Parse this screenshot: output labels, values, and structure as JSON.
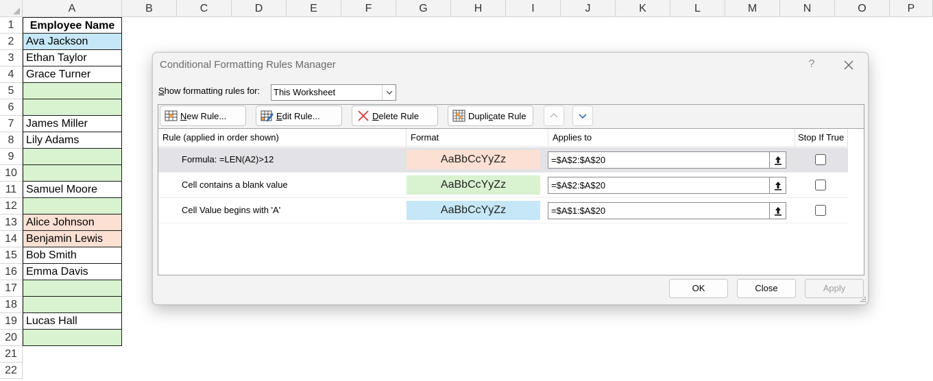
{
  "sheet": {
    "columns": [
      "A",
      "B",
      "C",
      "D",
      "E",
      "F",
      "G",
      "H",
      "I",
      "J",
      "K",
      "L",
      "M",
      "N",
      "O",
      "P"
    ],
    "rows": [
      "1",
      "2",
      "3",
      "4",
      "5",
      "6",
      "7",
      "8",
      "9",
      "10",
      "11",
      "12",
      "13",
      "14",
      "15",
      "16",
      "17",
      "18",
      "19",
      "20",
      "21",
      "22"
    ],
    "colA": [
      {
        "text": "Employee Name",
        "fill": "#ffffff"
      },
      {
        "text": "Ava Jackson",
        "fill": "#c6e7f7"
      },
      {
        "text": "Ethan Taylor",
        "fill": "#ffffff"
      },
      {
        "text": "Grace Turner",
        "fill": "#ffffff"
      },
      {
        "text": "",
        "fill": "#d9f2d0"
      },
      {
        "text": "",
        "fill": "#d9f2d0"
      },
      {
        "text": "James Miller",
        "fill": "#ffffff"
      },
      {
        "text": "Lily Adams",
        "fill": "#ffffff"
      },
      {
        "text": "",
        "fill": "#d9f2d0"
      },
      {
        "text": "",
        "fill": "#d9f2d0"
      },
      {
        "text": "Samuel Moore",
        "fill": "#ffffff"
      },
      {
        "text": "",
        "fill": "#d9f2d0"
      },
      {
        "text": "Alice Johnson",
        "fill": "#fce0d3"
      },
      {
        "text": "Benjamin Lewis",
        "fill": "#fce0d3"
      },
      {
        "text": "Bob Smith",
        "fill": "#ffffff"
      },
      {
        "text": "Emma Davis",
        "fill": "#ffffff"
      },
      {
        "text": "",
        "fill": "#d9f2d0"
      },
      {
        "text": "",
        "fill": "#d9f2d0"
      },
      {
        "text": "Lucas Hall",
        "fill": "#ffffff"
      },
      {
        "text": "",
        "fill": "#d9f2d0"
      }
    ]
  },
  "dialog": {
    "title": "Conditional Formatting Rules Manager",
    "help": "?",
    "show_label_pre": "",
    "show_label_u": "S",
    "show_label_post": "how formatting rules for:",
    "scope_value": "This Worksheet",
    "toolbar": {
      "new_u": "N",
      "new_rest": "ew Rule...",
      "edit_u": "E",
      "edit_rest": "dit Rule...",
      "delete_u": "D",
      "delete_rest": "elete Rule",
      "dup_pre": "Dupli",
      "dup_u": "c",
      "dup_rest": "ate Rule"
    },
    "columns": {
      "rule": "Rule (applied in order shown)",
      "format": "Format",
      "applies": "Applies to",
      "stop": "Stop If True"
    },
    "rules": [
      {
        "rule": "Formula: =LEN(A2)>12",
        "preview": "AaBbCcYyZz",
        "fill": "#fce0d3",
        "applies_to": "=$A$2:$A$20",
        "selected": true
      },
      {
        "rule": "Cell contains a blank value",
        "preview": "AaBbCcYyZz",
        "fill": "#d9f2d0",
        "applies_to": "=$A$2:$A$20",
        "selected": false
      },
      {
        "rule": "Cell Value begins with 'A'",
        "preview": "AaBbCcYyZz",
        "fill": "#c6e7f7",
        "applies_to": "=$A$1:$A$20",
        "selected": false
      }
    ],
    "buttons": {
      "ok": "OK",
      "close": "Close",
      "apply": "Apply"
    }
  },
  "colors": {
    "accent_blue": "#2e6fbf",
    "delete_red": "#d83b3b"
  }
}
